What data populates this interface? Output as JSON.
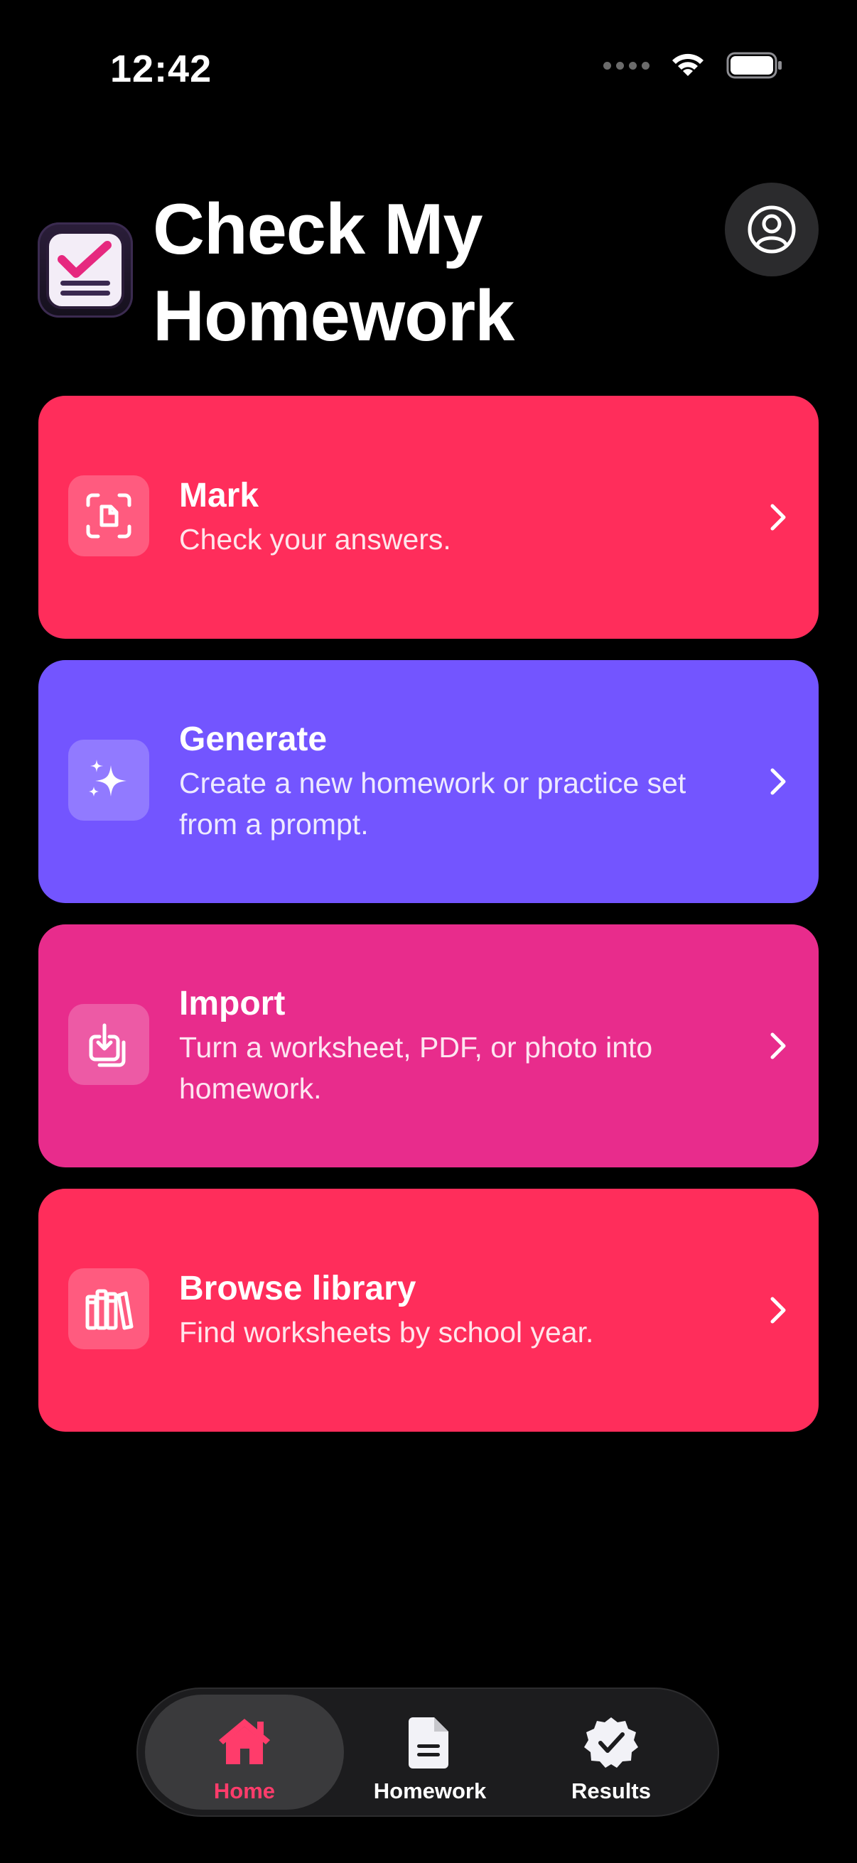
{
  "status_bar": {
    "time": "12:42"
  },
  "header": {
    "title_line1": "Check My",
    "title_line2": "Homework"
  },
  "colors": {
    "mark": "#ff2d5b",
    "generate": "#7355ff",
    "import": "#e82c8c",
    "library": "#ff2d5b",
    "tab_active": "#ff3c6b"
  },
  "cards": [
    {
      "icon": "scan-document-icon",
      "title": "Mark",
      "subtitle": "Check your answers."
    },
    {
      "icon": "sparkles-icon",
      "title": "Generate",
      "subtitle": "Create a new homework or practice set from a prompt."
    },
    {
      "icon": "import-icon",
      "title": "Import",
      "subtitle": "Turn a worksheet, PDF, or photo into homework."
    },
    {
      "icon": "books-icon",
      "title": "Browse library",
      "subtitle": "Find worksheets by school year."
    }
  ],
  "tabbar": {
    "tabs": [
      {
        "icon": "home-icon",
        "label": "Home",
        "active": true
      },
      {
        "icon": "document-icon",
        "label": "Homework",
        "active": false
      },
      {
        "icon": "checkmark-seal-icon",
        "label": "Results",
        "active": false
      }
    ]
  }
}
